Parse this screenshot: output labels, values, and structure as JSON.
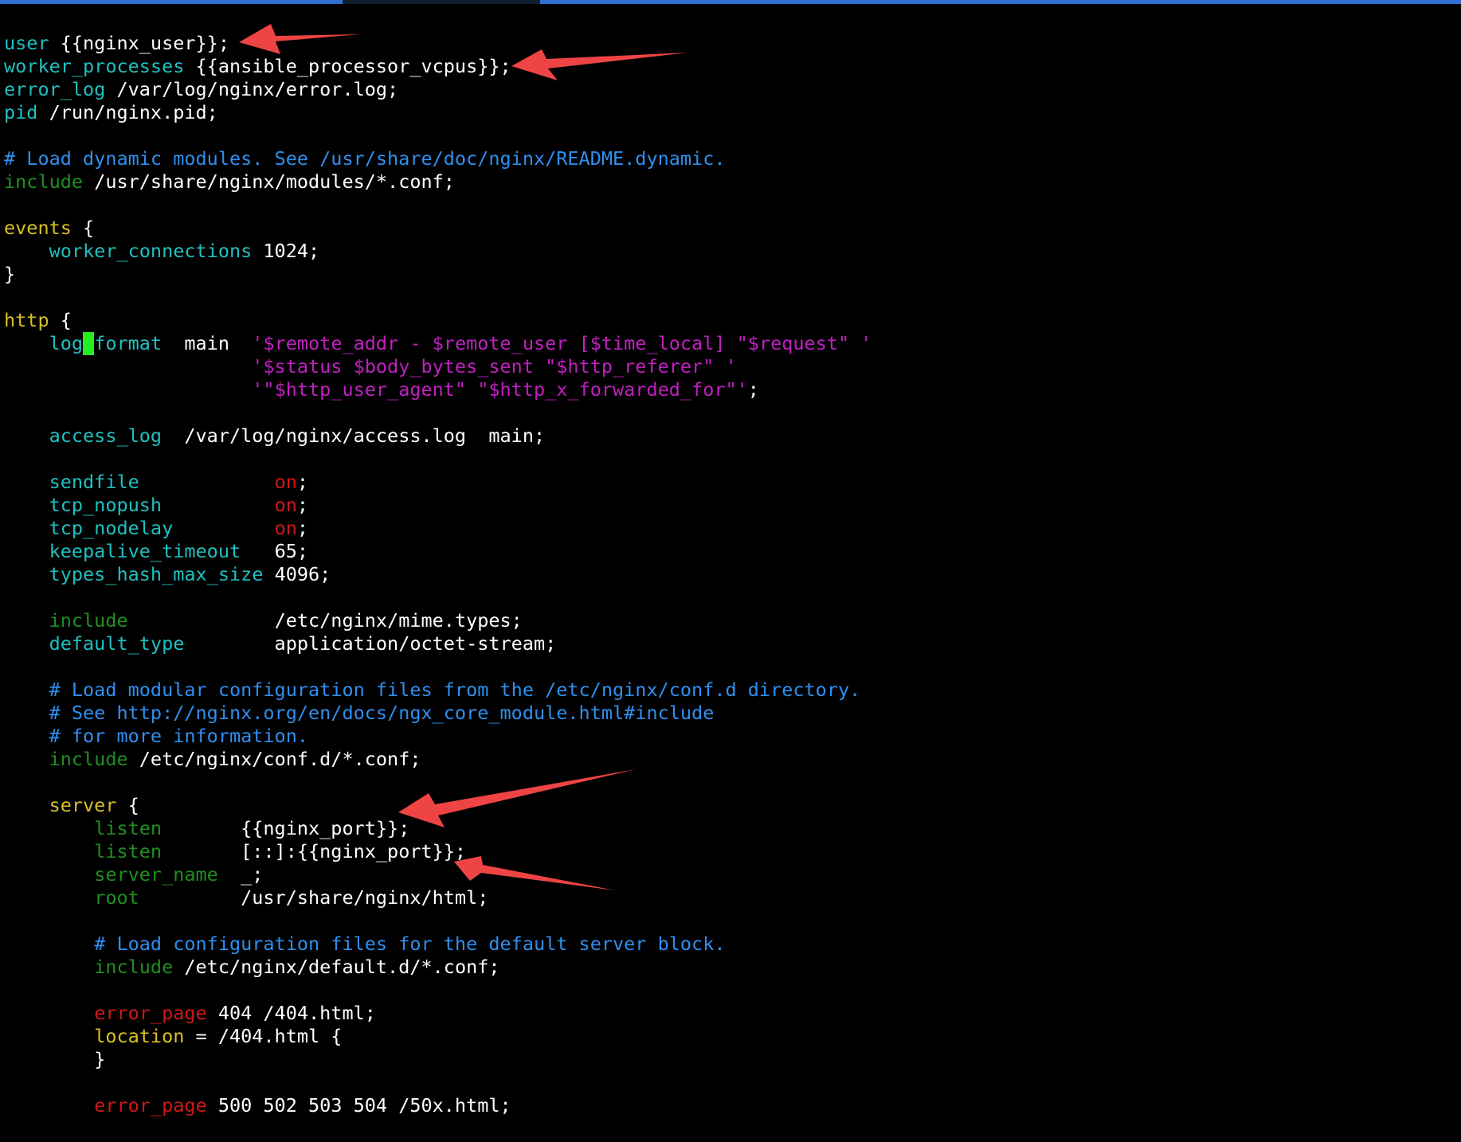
{
  "colors": {
    "background": "#000000",
    "directive": "#20c0c0",
    "block": "#d8c020",
    "include": "#1f8f1f",
    "comment": "#2f8fef",
    "string": "#c020c0",
    "value_on": "#d01818",
    "cursor": "#22ee22",
    "annotation_arrow": "#ef4444"
  },
  "editor": {
    "lines": [
      [
        {
          "c": "kw",
          "t": "user"
        },
        {
          "c": "plain",
          "t": " {{nginx_user}};"
        }
      ],
      [
        {
          "c": "kw",
          "t": "worker_processes"
        },
        {
          "c": "plain",
          "t": " {{ansible_processor_vcpus}};"
        }
      ],
      [
        {
          "c": "kw",
          "t": "error_log"
        },
        {
          "c": "plain",
          "t": " /var/log/nginx/error.log;"
        }
      ],
      [
        {
          "c": "kw",
          "t": "pid"
        },
        {
          "c": "plain",
          "t": " /run/nginx.pid;"
        }
      ],
      [],
      [
        {
          "c": "cmt",
          "t": "# Load dynamic modules. See /usr/share/doc/nginx/README.dynamic."
        }
      ],
      [
        {
          "c": "inc",
          "t": "include"
        },
        {
          "c": "plain",
          "t": " /usr/share/nginx/modules/*.conf;"
        }
      ],
      [],
      [
        {
          "c": "block",
          "t": "events"
        },
        {
          "c": "plain",
          "t": " {"
        }
      ],
      [
        {
          "c": "plain",
          "t": "    "
        },
        {
          "c": "kw",
          "t": "worker_connections"
        },
        {
          "c": "plain",
          "t": " 1024;"
        }
      ],
      [
        {
          "c": "plain",
          "t": "}"
        }
      ],
      [],
      [
        {
          "c": "block",
          "t": "http"
        },
        {
          "c": "plain",
          "t": " {"
        }
      ],
      [
        {
          "c": "plain",
          "t": "    "
        },
        {
          "c": "kw",
          "t": "log"
        },
        {
          "c": "cursor",
          "t": "_"
        },
        {
          "c": "kw",
          "t": "format"
        },
        {
          "c": "plain",
          "t": "  main  "
        },
        {
          "c": "str",
          "t": "'$remote_addr - $remote_user [$time_local] \"$request\" '"
        }
      ],
      [
        {
          "c": "plain",
          "t": "                      "
        },
        {
          "c": "str",
          "t": "'$status $body_bytes_sent \"$http_referer\" '"
        }
      ],
      [
        {
          "c": "plain",
          "t": "                      "
        },
        {
          "c": "str",
          "t": "'\"$http_user_agent\" \"$http_x_forwarded_for\"'"
        },
        {
          "c": "plain",
          "t": ";"
        }
      ],
      [],
      [
        {
          "c": "plain",
          "t": "    "
        },
        {
          "c": "kw",
          "t": "access_log"
        },
        {
          "c": "plain",
          "t": "  /var/log/nginx/access.log  main;"
        }
      ],
      [],
      [
        {
          "c": "plain",
          "t": "    "
        },
        {
          "c": "kw",
          "t": "sendfile"
        },
        {
          "c": "plain",
          "t": "            "
        },
        {
          "c": "red",
          "t": "on"
        },
        {
          "c": "plain",
          "t": ";"
        }
      ],
      [
        {
          "c": "plain",
          "t": "    "
        },
        {
          "c": "kw",
          "t": "tcp_nopush"
        },
        {
          "c": "plain",
          "t": "          "
        },
        {
          "c": "red",
          "t": "on"
        },
        {
          "c": "plain",
          "t": ";"
        }
      ],
      [
        {
          "c": "plain",
          "t": "    "
        },
        {
          "c": "kw",
          "t": "tcp_nodelay"
        },
        {
          "c": "plain",
          "t": "         "
        },
        {
          "c": "red",
          "t": "on"
        },
        {
          "c": "plain",
          "t": ";"
        }
      ],
      [
        {
          "c": "plain",
          "t": "    "
        },
        {
          "c": "kw",
          "t": "keepalive_timeout"
        },
        {
          "c": "plain",
          "t": "   65;"
        }
      ],
      [
        {
          "c": "plain",
          "t": "    "
        },
        {
          "c": "kw",
          "t": "types_hash_max_size"
        },
        {
          "c": "plain",
          "t": " 4096;"
        }
      ],
      [],
      [
        {
          "c": "plain",
          "t": "    "
        },
        {
          "c": "inc",
          "t": "include"
        },
        {
          "c": "plain",
          "t": "             /etc/nginx/mime.types;"
        }
      ],
      [
        {
          "c": "plain",
          "t": "    "
        },
        {
          "c": "kw",
          "t": "default_type"
        },
        {
          "c": "plain",
          "t": "        application/octet-stream;"
        }
      ],
      [],
      [
        {
          "c": "plain",
          "t": "    "
        },
        {
          "c": "cmt",
          "t": "# Load modular configuration files from the /etc/nginx/conf.d directory."
        }
      ],
      [
        {
          "c": "plain",
          "t": "    "
        },
        {
          "c": "cmt",
          "t": "# See http://nginx.org/en/docs/ngx_core_module.html#include"
        }
      ],
      [
        {
          "c": "plain",
          "t": "    "
        },
        {
          "c": "cmt",
          "t": "# for more information."
        }
      ],
      [
        {
          "c": "plain",
          "t": "    "
        },
        {
          "c": "inc",
          "t": "include"
        },
        {
          "c": "plain",
          "t": " /etc/nginx/conf.d/*.conf;"
        }
      ],
      [],
      [
        {
          "c": "plain",
          "t": "    "
        },
        {
          "c": "block",
          "t": "server"
        },
        {
          "c": "plain",
          "t": " {"
        }
      ],
      [
        {
          "c": "plain",
          "t": "        "
        },
        {
          "c": "inc",
          "t": "listen"
        },
        {
          "c": "plain",
          "t": "       {{nginx_port}};"
        }
      ],
      [
        {
          "c": "plain",
          "t": "        "
        },
        {
          "c": "inc",
          "t": "listen"
        },
        {
          "c": "plain",
          "t": "       [::]:{{nginx_port}};"
        }
      ],
      [
        {
          "c": "plain",
          "t": "        "
        },
        {
          "c": "inc",
          "t": "server_name"
        },
        {
          "c": "plain",
          "t": "  _;"
        }
      ],
      [
        {
          "c": "plain",
          "t": "        "
        },
        {
          "c": "inc",
          "t": "root"
        },
        {
          "c": "plain",
          "t": "         /usr/share/nginx/html;"
        }
      ],
      [],
      [
        {
          "c": "plain",
          "t": "        "
        },
        {
          "c": "cmt",
          "t": "# Load configuration files for the default server block."
        }
      ],
      [
        {
          "c": "plain",
          "t": "        "
        },
        {
          "c": "inc",
          "t": "include"
        },
        {
          "c": "plain",
          "t": " /etc/nginx/default.d/*.conf;"
        }
      ],
      [],
      [
        {
          "c": "plain",
          "t": "        "
        },
        {
          "c": "red",
          "t": "error_page"
        },
        {
          "c": "plain",
          "t": " 404 /404.html;"
        }
      ],
      [
        {
          "c": "plain",
          "t": "        "
        },
        {
          "c": "block",
          "t": "location"
        },
        {
          "c": "plain",
          "t": " = /404.html {"
        }
      ],
      [
        {
          "c": "plain",
          "t": "        }"
        }
      ],
      [],
      [
        {
          "c": "plain",
          "t": "        "
        },
        {
          "c": "red",
          "t": "error_page"
        },
        {
          "c": "plain",
          "t": " 500 502 503 504 /50x.html;"
        }
      ]
    ]
  }
}
